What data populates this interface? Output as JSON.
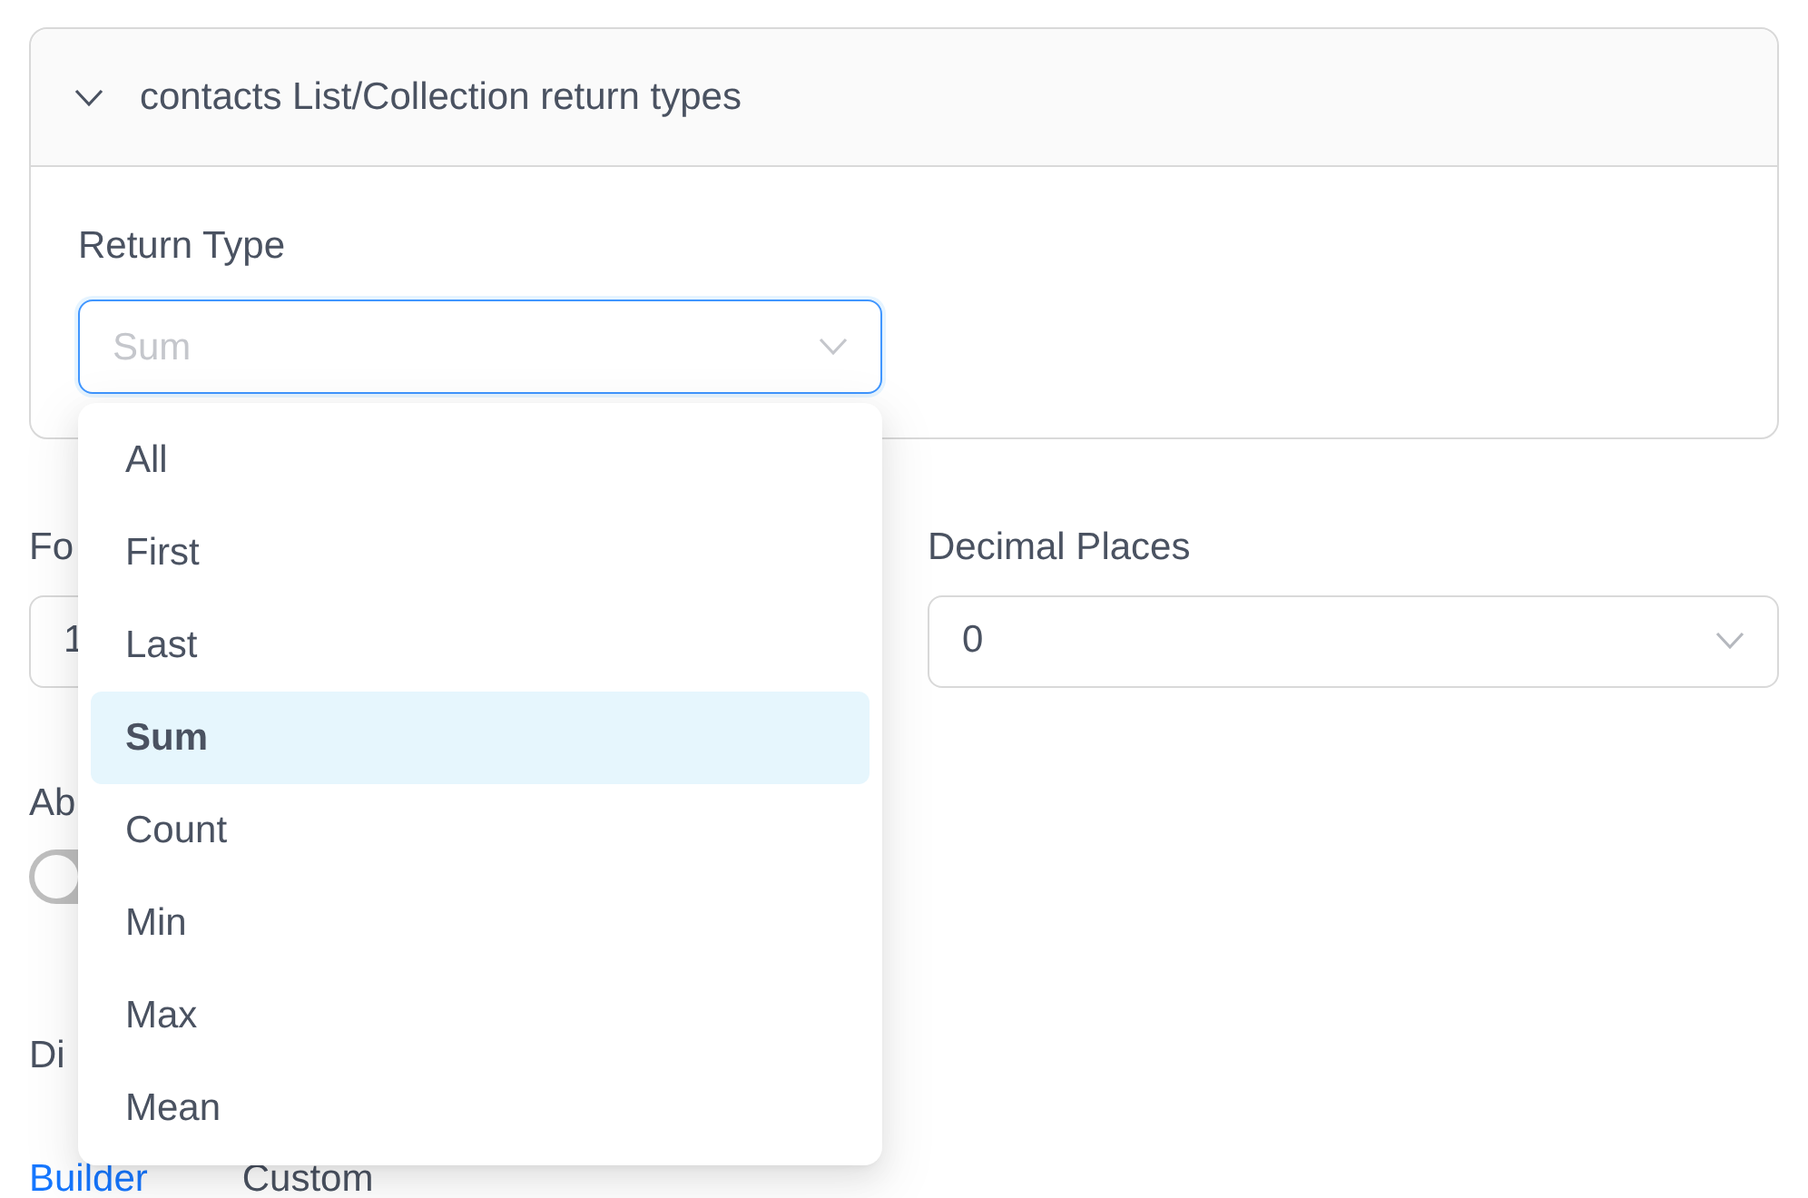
{
  "panel": {
    "title": "contacts List/Collection return types",
    "expanded": true,
    "return_type": {
      "label": "Return Type",
      "value": "Sum",
      "open": true,
      "options": [
        {
          "label": "All",
          "selected": false
        },
        {
          "label": "First",
          "selected": false
        },
        {
          "label": "Last",
          "selected": false
        },
        {
          "label": "Sum",
          "selected": true
        },
        {
          "label": "Count",
          "selected": false
        },
        {
          "label": "Min",
          "selected": false
        },
        {
          "label": "Max",
          "selected": false
        },
        {
          "label": "Mean",
          "selected": false
        }
      ]
    }
  },
  "fields": [
    {
      "label": "Fo",
      "value": "1",
      "kind": "input"
    },
    {
      "label": "Decimal Places",
      "value": "0",
      "kind": "select"
    }
  ],
  "toggle": {
    "label": "Ab",
    "on": false
  },
  "display": {
    "label": "Di",
    "tabs": [
      {
        "label": "Builder",
        "selected": true
      },
      {
        "label": "Custom",
        "selected": false
      }
    ]
  }
}
